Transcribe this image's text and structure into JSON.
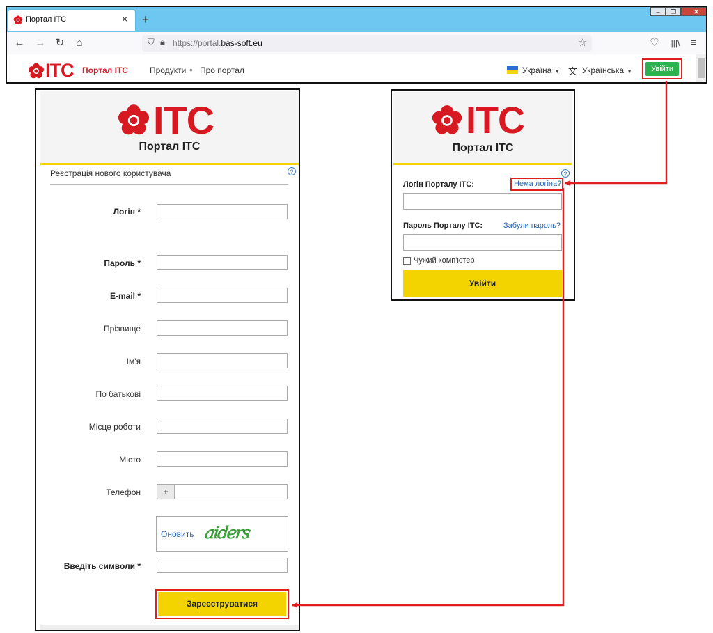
{
  "browser": {
    "tab_title": "Портал ІТС",
    "tab_close": "×",
    "new_tab": "+",
    "win_min": "–",
    "win_max": "❐",
    "win_close": "✕",
    "url_prefix": "https://portal.",
    "url_domain": "bas-soft.eu",
    "icons": [
      "back-icon",
      "forward-icon",
      "reload-icon",
      "home-icon",
      "shield-icon",
      "lock-icon",
      "star-icon",
      "pocket-icon",
      "library-icon",
      "menu-icon"
    ]
  },
  "site": {
    "logo_text": "ITC",
    "title": "Портал ІТС",
    "nav": [
      "Продукти",
      "Про портал"
    ],
    "nav_sep": "•",
    "country": "Україна",
    "language": "Українська",
    "login_button": "Увійти",
    "flag_colors": [
      "#2b6fd6",
      "#f7d318"
    ]
  },
  "registration": {
    "logo_text": "ITC",
    "portal_title": "Портал ІТС",
    "subtitle": "Реєстрація нового користувача",
    "help": "?",
    "fields": [
      {
        "label": "Логін",
        "required": true,
        "star": "*"
      },
      {
        "label": "Пароль",
        "required": true,
        "star": "*"
      },
      {
        "label": "E-mail",
        "required": true,
        "star": "*"
      },
      {
        "label": "Прізвище",
        "required": false
      },
      {
        "label": "Ім'я",
        "required": false
      },
      {
        "label": "По батькові",
        "required": false
      },
      {
        "label": "Місце роботи",
        "required": false
      },
      {
        "label": "Місто",
        "required": false
      },
      {
        "label": "Телефон",
        "required": false
      }
    ],
    "phone_prefix": "+",
    "captcha_refresh": "Оновить",
    "captcha_text": "aiders",
    "captcha_label": "Введіть символи",
    "captcha_star": "*",
    "submit": "Зареєструватися"
  },
  "login": {
    "logo_text": "ITC",
    "portal_title": "Портал ІТС",
    "help": "?",
    "login_label": "Логін Порталу ІТС:",
    "no_login": "Нема логіна?",
    "password_label": "Пароль Порталу ІТС:",
    "forgot": "Забули пароль?",
    "foreign_pc": "Чужий комп'ютер",
    "submit": "Увійти"
  },
  "colors": {
    "brand_red": "#d71921",
    "accent_yellow": "#f4d400",
    "login_green": "#2bb24c",
    "annotation_red": "#e02020",
    "link_blue": "#2a66b8"
  }
}
